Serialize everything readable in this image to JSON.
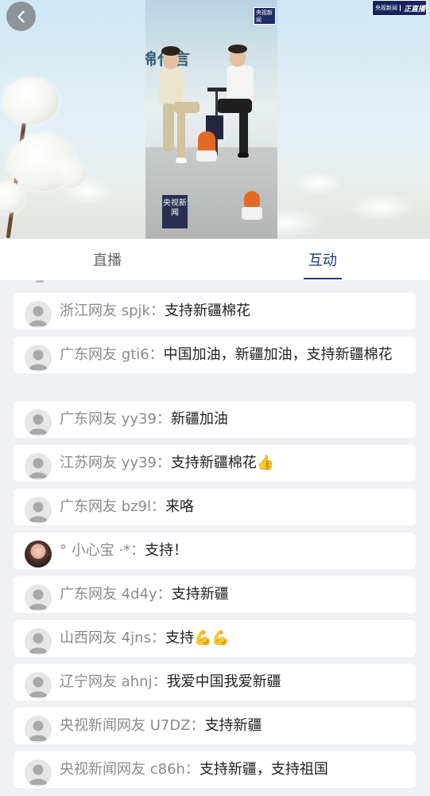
{
  "video": {
    "stream_slogan": "棉代言",
    "cctv_badge": "央视新闻",
    "live_badge_brand": "央视新闻",
    "live_badge_text": "正直播",
    "cube_logo": "央视新闻"
  },
  "tabs": [
    {
      "label": "直播",
      "active": false
    },
    {
      "label": "互动",
      "active": true
    }
  ],
  "colors": {
    "accent": "#1a3a7a",
    "background": "#eef0f3"
  },
  "comments": [
    {
      "user": "浙江网友 spjk：",
      "message": "支持新疆棉花",
      "avatar": "default-avatar-icon"
    },
    {
      "user": "广东网友 gti6：",
      "message": "中国加油，新疆加油，支持新疆棉花",
      "avatar": "default-avatar-icon"
    },
    {
      "user": "广东网友 yy39：",
      "message": "新疆加油",
      "avatar": "default-avatar-icon"
    },
    {
      "user": "江苏网友 yy39：",
      "message": "支持新疆棉花👍",
      "avatar": "default-avatar-icon"
    },
    {
      "user": "广东网友 bz9l：",
      "message": "来咯",
      "avatar": "default-avatar-icon"
    },
    {
      "user": "°  小心宝 ·*：",
      "message": "支持！",
      "avatar": "photo-avatar"
    },
    {
      "user": "广东网友 4d4y：",
      "message": "支持新疆",
      "avatar": "default-avatar-icon"
    },
    {
      "user": "山西网友 4jns：",
      "message": "支持💪💪",
      "avatar": "default-avatar-icon"
    },
    {
      "user": "辽宁网友 ahnj：",
      "message": "我爱中国我爱新疆",
      "avatar": "default-avatar-icon"
    },
    {
      "user": "央视新闻网友 U7DZ：",
      "message": "支持新疆",
      "avatar": "default-avatar-icon"
    },
    {
      "user": "央视新闻网友 c86h：",
      "message": "支持新疆，支持祖国",
      "avatar": "default-avatar-icon"
    }
  ]
}
